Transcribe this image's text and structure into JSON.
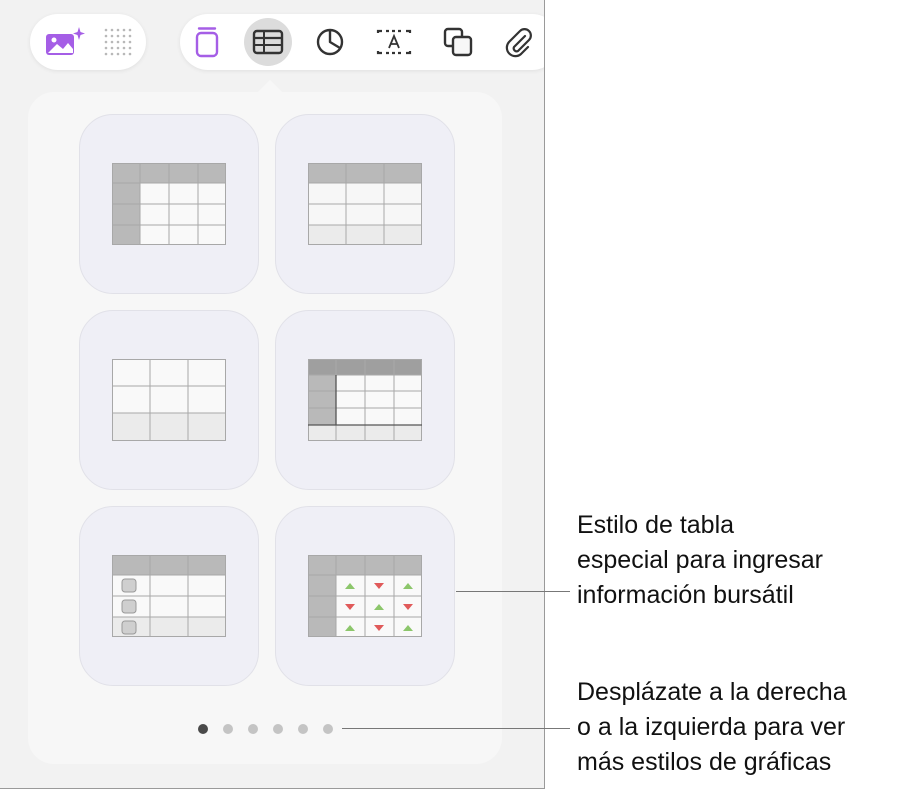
{
  "toolbar": {
    "left_buttons": [
      {
        "icon": "image-sparkle-icon",
        "color": "#a55ee6"
      },
      {
        "icon": "dot-grid-icon",
        "color": "#b8b8b8"
      }
    ],
    "right_buttons": [
      {
        "icon": "text-box-icon",
        "color": "#a55ee6"
      },
      {
        "icon": "table-icon",
        "selected": true
      },
      {
        "icon": "chart-icon"
      },
      {
        "icon": "text-frame-icon"
      },
      {
        "icon": "shapes-icon"
      },
      {
        "icon": "attachment-icon"
      }
    ]
  },
  "table_styles": [
    {
      "name": "header-row-and-column"
    },
    {
      "name": "header-row"
    },
    {
      "name": "plain"
    },
    {
      "name": "header-row-column-footer"
    },
    {
      "name": "checklist"
    },
    {
      "name": "stock"
    }
  ],
  "pagination": {
    "count": 6,
    "active": 0
  },
  "callouts": {
    "stock_style": "Estilo de tabla\nespecial para ingresar\ninformación bursátil",
    "scroll_hint": "Desplázate a la derecha\no a la izquierda para ver\nmás estilos de gráficas"
  },
  "colors": {
    "accent": "#a55ee6",
    "up_arrow": "#8cc66b",
    "down_arrow": "#e05a5a"
  }
}
